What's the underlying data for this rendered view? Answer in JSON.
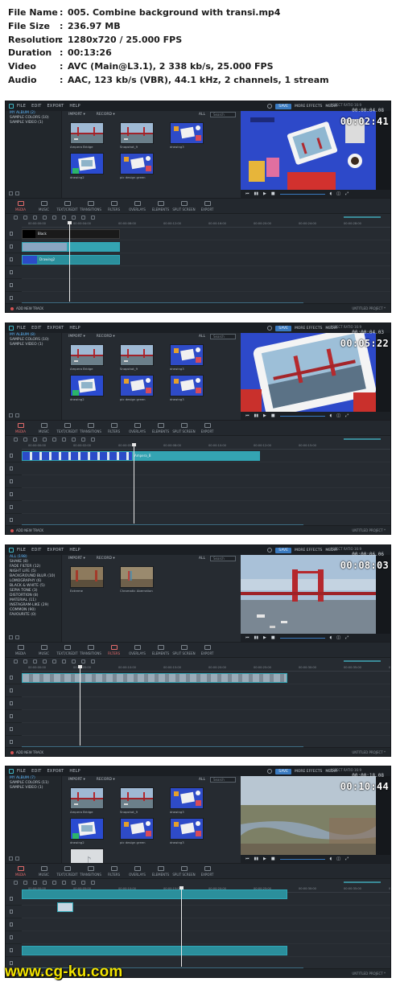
{
  "media_info": [
    {
      "key": "File Name",
      "value": "005. Combine background with transi.mp4"
    },
    {
      "key": "File Size",
      "value": "236.97 MB"
    },
    {
      "key": "Resolution",
      "value": "1280x720 / 25.000 FPS"
    },
    {
      "key": "Duration",
      "value": "00:13:26"
    },
    {
      "key": "Video",
      "value": "AVC (Main@L3.1), 2 338 kb/s, 25.000 FPS"
    },
    {
      "key": "Audio",
      "value": "AAC, 123 kb/s (VBR), 44.1 kHz, 2 channels, 1 stream"
    }
  ],
  "menu": {
    "file": "FILE",
    "edit": "EDIT",
    "export": "EXPORT",
    "help": "HELP",
    "save": "SAVE",
    "more_effects": "MORE EFFECTS",
    "media": "MEDIA"
  },
  "library": {
    "import": "IMPORT ▾",
    "record": "RECORD ▾",
    "all": "ALL",
    "search_placeholder": "Search"
  },
  "tabs": [
    "MEDIA",
    "MUSIC",
    "TEXT/CREDIT",
    "TRANSITIONS",
    "FILTERS",
    "OVERLAYS",
    "ELEMENTS",
    "SPLIT SCREEN",
    "EXPORT"
  ],
  "aspect_label": "ASPECT RATIO 16:9",
  "add_track": "ADD NEW TRACK",
  "project_name": "UNTITLED PROJECT *",
  "frames": [
    {
      "timecode": "00:02:41",
      "counter": "00:00:04.08",
      "active_tab": 0,
      "sidebar": [
        "MY ALBUM (2)",
        "SAMPLE COLORS (10)",
        "SAMPLE VIDEO (1)"
      ],
      "thumbs": [
        "Ampera Bridge",
        "Snapshot_9",
        "drawing3",
        "drawing2",
        "pic design green"
      ],
      "ruler": [
        "00:00:00:00",
        "00:00:04:00",
        "00:00:08:00",
        "00:00:12:00",
        "00:00:16:00",
        "00:00:20:00",
        "00:00:24:00",
        "00:00:28:00"
      ],
      "clip_labels": [
        "Black",
        "",
        "Drawing2"
      ]
    },
    {
      "timecode": "00:05:22",
      "counter": "00:00:04.03",
      "active_tab": 0,
      "sidebar": [
        "MY ALBUM (8)",
        "SAMPLE COLORS (10)",
        "SAMPLE VIDEO (1)"
      ],
      "thumbs": [
        "Ampera Bridge",
        "Snapshot_9",
        "drawing3",
        "drawing2",
        "pic design green",
        "drawing3"
      ],
      "ruler": [
        "00:00:00:00",
        "00:00:02:00",
        "00:00:05:00",
        "00:00:08:00",
        "00:00:10:00",
        "00:00:12:00",
        "00:00:15:00"
      ],
      "clip_labels": [
        "Ampera_B"
      ]
    },
    {
      "timecode": "00:08:03",
      "counter": "00:00:06.06",
      "active_tab": 4,
      "sidebar": [
        "ALL (198)",
        "SHAKE (8)",
        "FADE FILTER (12)",
        "NIGHT LIFE (5)",
        "BACKGROUND BLUR (10)",
        "LOMOGRAPHY (6)",
        "BLACK & WHITE (5)",
        "SEPIA TONE (3)",
        "DISTORTION (8)",
        "MATERIAL (11)",
        "INSTAGRAM-LIKE (29)",
        "COMMON (90)",
        "FAVOURITE (0)"
      ],
      "thumbs": [
        "Extreme",
        "Chromatic Aberration"
      ],
      "ruler": [
        "00:00:00:00",
        "00:00:05:00",
        "00:00:10:00",
        "00:00:15:00",
        "00:00:20:00",
        "00:00:25:00",
        "00:00:30:00",
        "00:00:35:00",
        "00:00:40:00"
      ],
      "clip_labels": [
        ""
      ]
    },
    {
      "timecode": "00:10:44",
      "counter": "00:00:18.08",
      "active_tab": 0,
      "sidebar": [
        "MY ALBUM (7)",
        "SAMPLE COLORS (11)",
        "SAMPLE VIDEO (1)"
      ],
      "thumbs": [
        "Ampera Bridge",
        "Snapshot_9",
        "drawing3",
        "drawing2",
        "pic design green",
        "drawing3",
        "Free Music For Vlogs - Clic"
      ],
      "ruler": [
        "00:00:00:00",
        "00:00:05:00",
        "00:00:10:00",
        "00:00:15:00",
        "00:00:20:00",
        "00:00:25:00",
        "00:00:30:00",
        "00:00:35:00",
        "00:00:40:00"
      ],
      "clip_labels": [
        ""
      ]
    }
  ],
  "watermark": "www.cg-ku.com",
  "colors": {
    "accent": "#3a7ac0",
    "clip": "#2b8f9c",
    "timecode": "#ffffff",
    "watermark": "#f2e300",
    "active_tab": "#e36b6b"
  }
}
